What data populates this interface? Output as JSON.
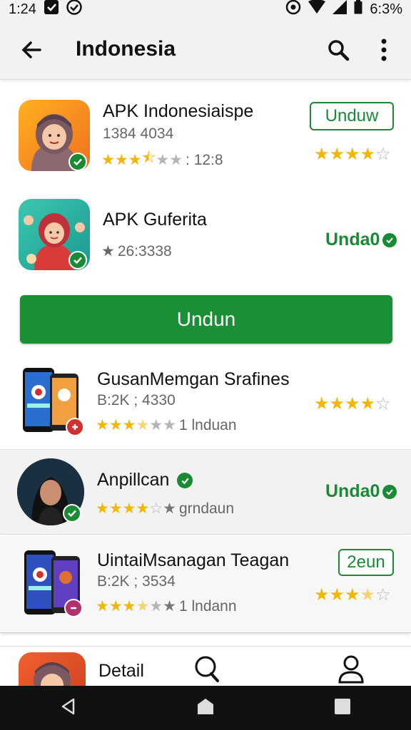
{
  "status": {
    "time": "1:24",
    "battery": "6:3%"
  },
  "header": {
    "title": "Indonesia"
  },
  "apps": [
    {
      "name": "APK Indonesiaispe",
      "meta": "1384 4034",
      "rating_text": ": 12:8",
      "action": "Unduw"
    },
    {
      "name": "APK Guferita",
      "meta": "26:3338",
      "action": "Unda0"
    },
    {
      "name": "GusanMemgan Srafines",
      "meta": "B:2K ; 4330",
      "rating_text": "1 lnduan"
    },
    {
      "name": "Anpillcan",
      "rating_text": "grndaun",
      "action": "Unda0"
    },
    {
      "name": "UintaiMsanagan Teagan",
      "meta": "B:2K ; 3534",
      "rating_text": "1 lndann",
      "action": "2eun"
    }
  ],
  "main_button": {
    "label": "Undun"
  },
  "bottom_nav": {
    "detail_label": "Detail"
  },
  "colors": {
    "accent": "#1a8a34",
    "star": "#f2b705"
  },
  "icons": [
    "back-arrow-icon",
    "search-icon",
    "more-vert-icon",
    "verified-check-icon",
    "star-icon",
    "back-triangle-icon",
    "home-icon",
    "recents-icon",
    "profile-icon"
  ]
}
